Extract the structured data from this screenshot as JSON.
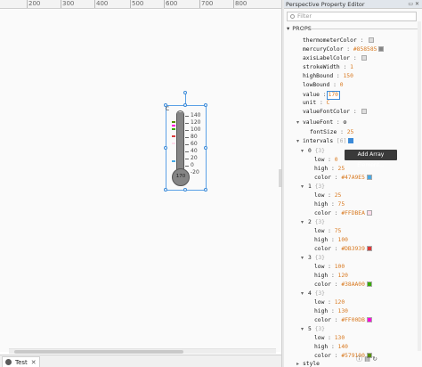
{
  "ruler": {
    "labels": [
      "200",
      "300",
      "400",
      "500",
      "600",
      "700",
      "800"
    ]
  },
  "tab": {
    "label": "Test",
    "close": "✕"
  },
  "thermometer": {
    "corner_label": "C",
    "value_label": "170",
    "ticks": [
      "140",
      "120",
      "100",
      "80",
      "60",
      "40",
      "20",
      "0",
      "-20"
    ]
  },
  "panel": {
    "title": "Perspective Property Editor",
    "window_controls": "▭ ✕",
    "filter_placeholder": "Filter",
    "section": "PROPS"
  },
  "props": [
    {
      "key": "thermometerColor",
      "value": ""
    },
    {
      "key": "mercuryColor",
      "value": "#858585"
    },
    {
      "key": "axisLabelColor",
      "value": ""
    },
    {
      "key": "strokeWidth",
      "value": "1"
    },
    {
      "key": "highBound",
      "value": "150"
    },
    {
      "key": "lowBound",
      "value": "0"
    },
    {
      "key": "value",
      "value": "170"
    },
    {
      "key": "unit",
      "value": "C"
    },
    {
      "key": "valueFontColor",
      "value": ""
    }
  ],
  "valueFont": {
    "key": "valueFont",
    "fontSize_key": "fontSize",
    "fontSize": "25"
  },
  "intervals": {
    "key": "intervals",
    "count": "[6]"
  },
  "tooltip": "Add Array Element...",
  "interval_items": [
    {
      "index": "0",
      "count": "{3}",
      "low": "0",
      "high": "25",
      "color": "#47A9E5"
    },
    {
      "index": "1",
      "count": "{3}",
      "low": "25",
      "high": "75",
      "color": "#FFDBEA"
    },
    {
      "index": "2",
      "count": "{3}",
      "low": "75",
      "high": "100",
      "color": "#DB3939"
    },
    {
      "index": "3",
      "count": "{3}",
      "low": "100",
      "high": "120",
      "color": "#38AA00"
    },
    {
      "index": "4",
      "count": "{3}",
      "low": "120",
      "high": "130",
      "color": "#FF00DB"
    },
    {
      "index": "5",
      "count": "{3}",
      "low": "130",
      "high": "140",
      "color": "#579100"
    }
  ],
  "labels": {
    "low": "low",
    "high": "high",
    "color": "color",
    "style": "style"
  },
  "bottom_tools": "ⓘ ▤ ↻"
}
